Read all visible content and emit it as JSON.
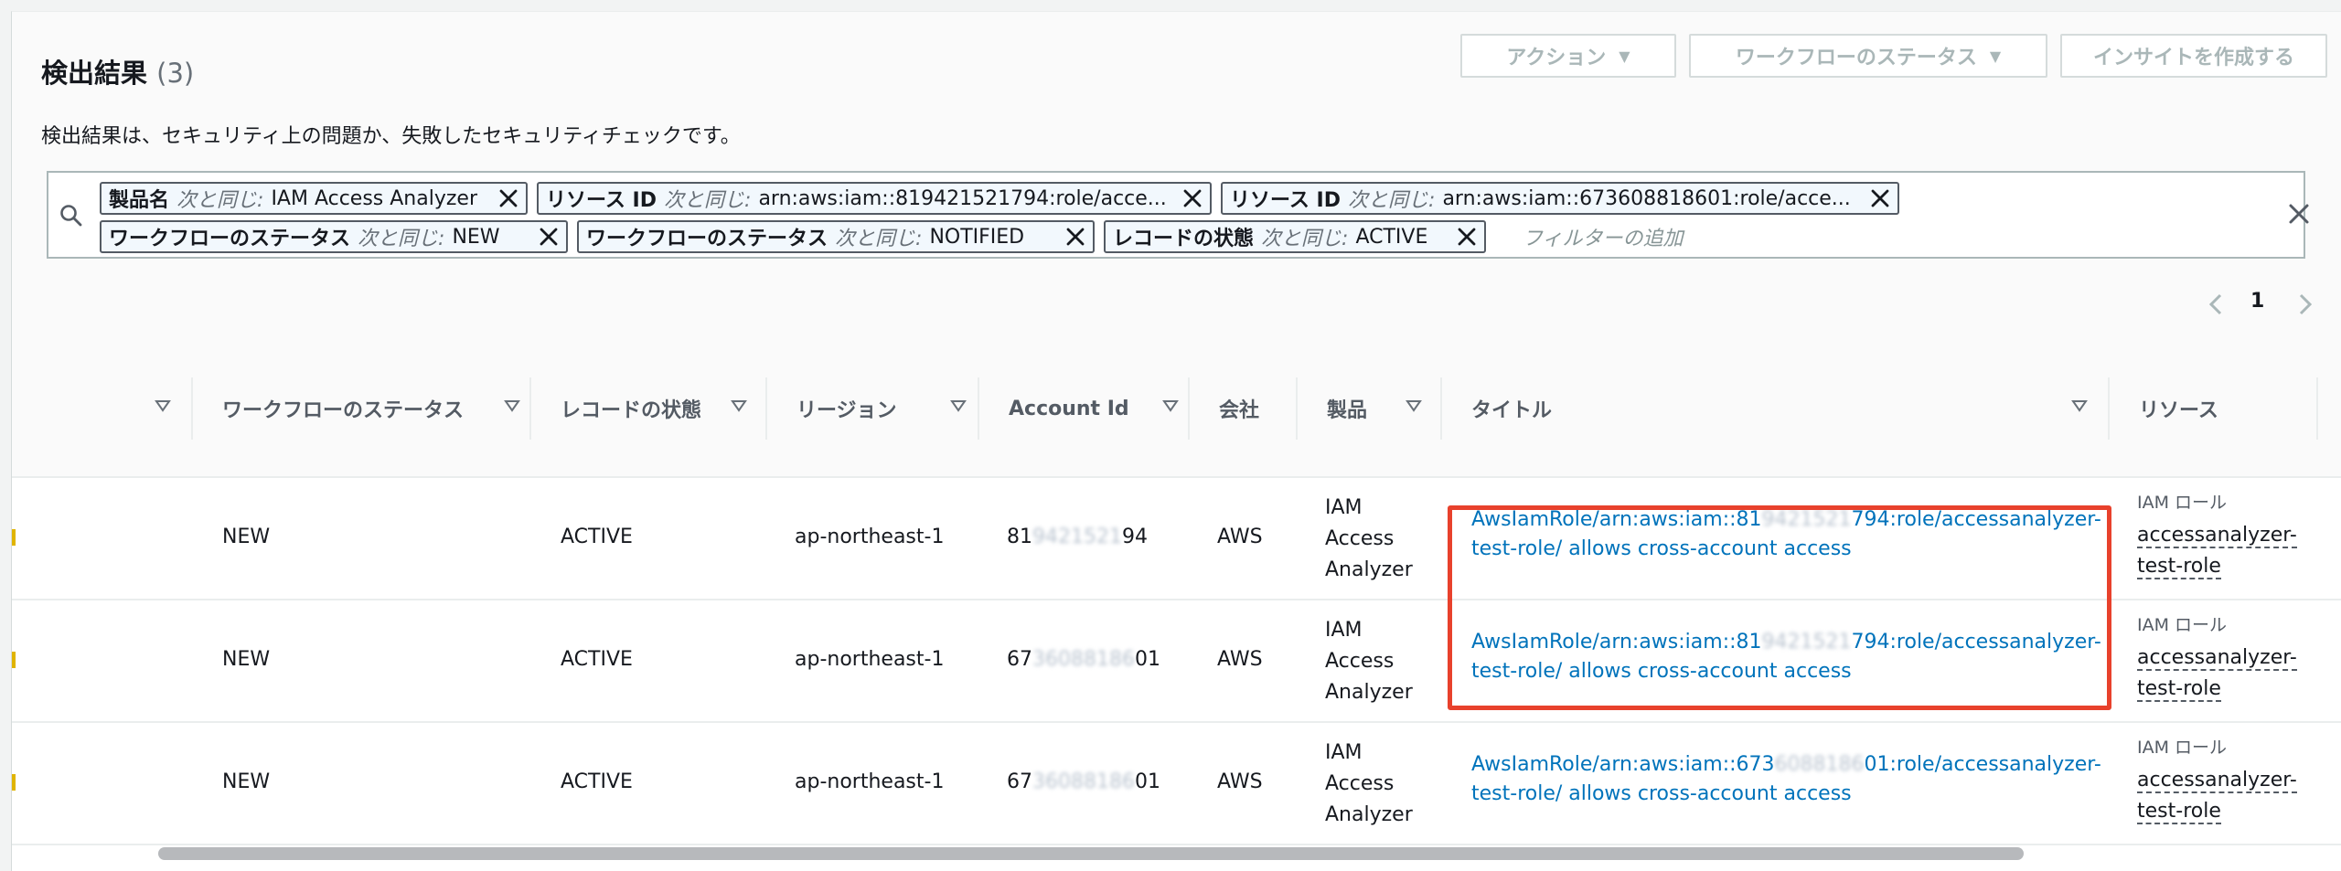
{
  "header": {
    "title": "検出結果",
    "count": "(3)",
    "description": "検出結果は、セキュリティ上の問題か、失敗したセキュリティチェックです。"
  },
  "buttons": {
    "actions": "アクション",
    "workflow_status": "ワークフローのステータス",
    "create_insight": "インサイトを作成する"
  },
  "filters": {
    "tokens": [
      {
        "key": "製品名",
        "op": "次と同じ:",
        "value": "IAM Access Analyzer"
      },
      {
        "key": "リソース ID",
        "op": "次と同じ:",
        "value": "arn:aws:iam::819421521794:role/acce..."
      },
      {
        "key": "リソース ID",
        "op": "次と同じ:",
        "value": "arn:aws:iam::673608818601:role/acce..."
      },
      {
        "key": "ワークフローのステータス",
        "op": "次と同じ:",
        "value": "NEW"
      },
      {
        "key": "ワークフローのステータス",
        "op": "次と同じ:",
        "value": "NOTIFIED"
      },
      {
        "key": "レコードの状態",
        "op": "次と同じ:",
        "value": "ACTIVE"
      }
    ],
    "placeholder": "フィルターの追加"
  },
  "pagination": {
    "current_page": "1"
  },
  "table": {
    "columns": [
      "ワークフローのステータス",
      "レコードの状態",
      "リージョン",
      "Account Id",
      "会社",
      "製品",
      "タイトル",
      "リソース"
    ],
    "rows": [
      {
        "workflow": "NEW",
        "record": "ACTIVE",
        "region": "ap-northeast-1",
        "account_a": "81",
        "account_mask": "9421521",
        "account_b": "94",
        "company": "AWS",
        "product_1": "IAM",
        "product_2": "Access",
        "product_3": "Analyzer",
        "title_a": "AwsIamRole/arn:aws:iam::81",
        "title_mask": "9421521",
        "title_b": "794:role/accessanalyzer-",
        "title_line2": "test-role/ allows cross-account access",
        "res_type": "IAM ロール",
        "res_name": "accessanalyzer-test-role"
      },
      {
        "workflow": "NEW",
        "record": "ACTIVE",
        "region": "ap-northeast-1",
        "account_a": "67",
        "account_mask": "36088186",
        "account_b": "01",
        "company": "AWS",
        "product_1": "IAM",
        "product_2": "Access",
        "product_3": "Analyzer",
        "title_a": "AwsIamRole/arn:aws:iam::81",
        "title_mask": "9421521",
        "title_b": "794:role/accessanalyzer-",
        "title_line2": "test-role/ allows cross-account access",
        "res_type": "IAM ロール",
        "res_name": "accessanalyzer-test-role"
      },
      {
        "workflow": "NEW",
        "record": "ACTIVE",
        "region": "ap-northeast-1",
        "account_a": "67",
        "account_mask": "36088186",
        "account_b": "01",
        "company": "AWS",
        "product_1": "IAM",
        "product_2": "Access",
        "product_3": "Analyzer",
        "title_a": "AwsIamRole/arn:aws:iam::673",
        "title_mask": "6088186",
        "title_b": "01:role/accessanalyzer-",
        "title_line2": "test-role/ allows cross-account access",
        "res_type": "IAM ロール",
        "res_name": "accessanalyzer-test-role"
      }
    ]
  },
  "colors": {
    "link": "#0073bb",
    "highlight": "#e8412c",
    "token_border": "#545b64"
  },
  "icons": [
    "search-icon",
    "close-icon",
    "caret-down-icon",
    "sort-caret-icon",
    "chevron-left-icon",
    "chevron-right-icon"
  ]
}
